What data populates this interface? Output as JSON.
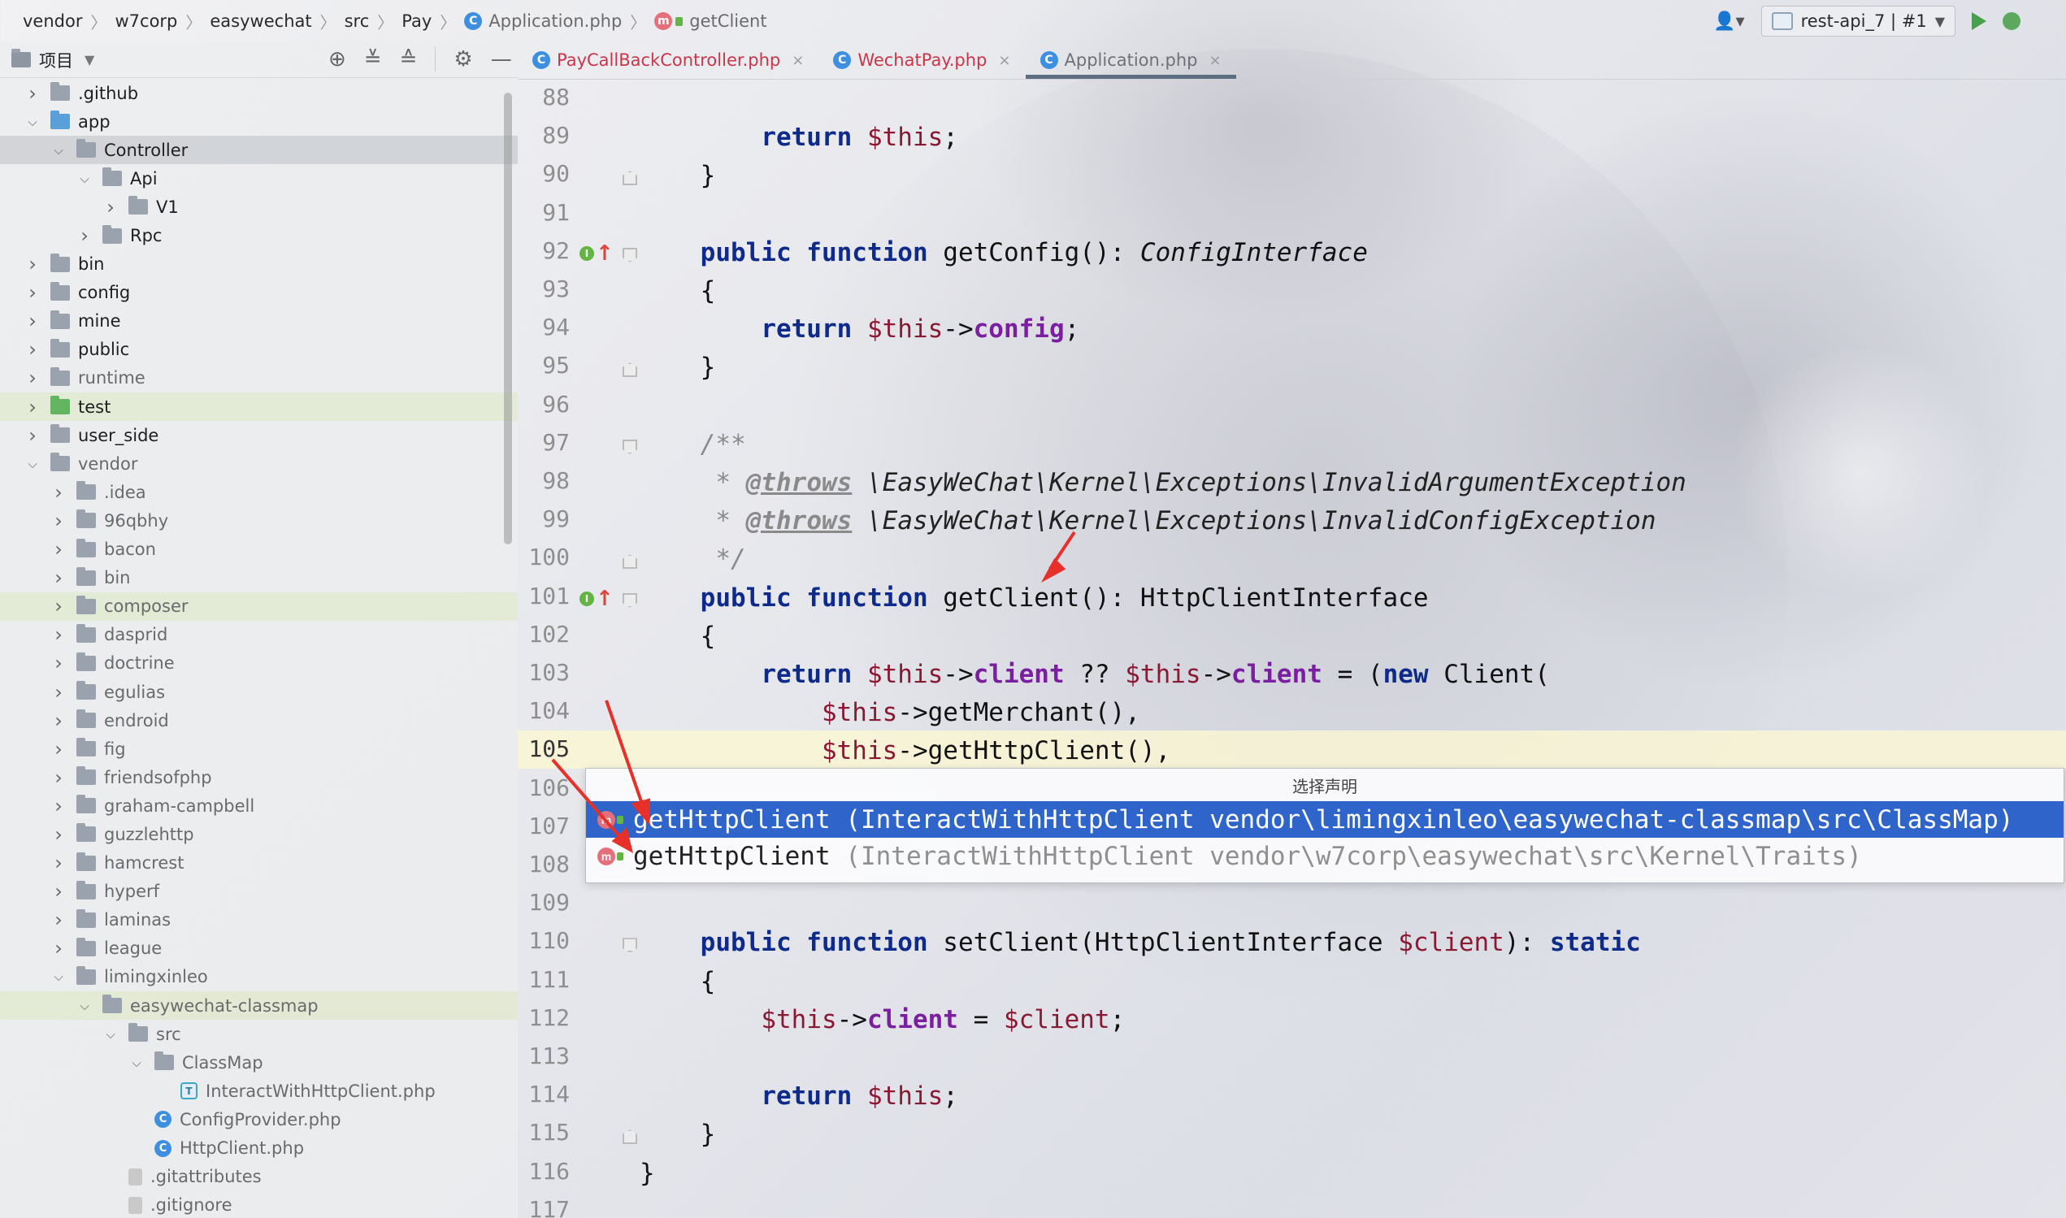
{
  "navbar": {
    "breadcrumbs": [
      "vendor",
      "w7corp",
      "easywechat",
      "src",
      "Pay"
    ],
    "file": "Application.php",
    "method": "getClient",
    "run_config": "rest-api_7 | #1"
  },
  "project_panel": {
    "title": "项目",
    "tree": [
      {
        "label": ".github",
        "depth": 0,
        "expanded": false
      },
      {
        "label": "app",
        "depth": 0,
        "expanded": true,
        "color": "blue"
      },
      {
        "label": "Controller",
        "depth": 1,
        "expanded": true,
        "selected": true
      },
      {
        "label": "Api",
        "depth": 2,
        "expanded": true
      },
      {
        "label": "V1",
        "depth": 3,
        "expanded": false
      },
      {
        "label": "Rpc",
        "depth": 2,
        "expanded": false
      },
      {
        "label": "bin",
        "depth": 0,
        "expanded": false
      },
      {
        "label": "config",
        "depth": 0,
        "expanded": false
      },
      {
        "label": "mine",
        "depth": 0,
        "expanded": false
      },
      {
        "label": "public",
        "depth": 0,
        "expanded": false
      },
      {
        "label": "runtime",
        "depth": 0,
        "expanded": false,
        "muted": true
      },
      {
        "label": "test",
        "depth": 0,
        "expanded": false,
        "color": "green",
        "highlight": true
      },
      {
        "label": "user_side",
        "depth": 0,
        "expanded": false
      },
      {
        "label": "vendor",
        "depth": 0,
        "expanded": true,
        "muted": true
      },
      {
        "label": ".idea",
        "depth": 1,
        "expanded": false,
        "muted": true
      },
      {
        "label": "96qbhy",
        "depth": 1,
        "expanded": false,
        "muted": true
      },
      {
        "label": "bacon",
        "depth": 1,
        "expanded": false,
        "muted": true
      },
      {
        "label": "bin",
        "depth": 1,
        "expanded": false,
        "muted": true
      },
      {
        "label": "composer",
        "depth": 1,
        "expanded": false,
        "muted": true,
        "highlight": true
      },
      {
        "label": "dasprid",
        "depth": 1,
        "expanded": false,
        "muted": true
      },
      {
        "label": "doctrine",
        "depth": 1,
        "expanded": false,
        "muted": true
      },
      {
        "label": "egulias",
        "depth": 1,
        "expanded": false,
        "muted": true
      },
      {
        "label": "endroid",
        "depth": 1,
        "expanded": false,
        "muted": true
      },
      {
        "label": "fig",
        "depth": 1,
        "expanded": false,
        "muted": true
      },
      {
        "label": "friendsofphp",
        "depth": 1,
        "expanded": false,
        "muted": true
      },
      {
        "label": "graham-campbell",
        "depth": 1,
        "expanded": false,
        "muted": true
      },
      {
        "label": "guzzlehttp",
        "depth": 1,
        "expanded": false,
        "muted": true
      },
      {
        "label": "hamcrest",
        "depth": 1,
        "expanded": false,
        "muted": true
      },
      {
        "label": "hyperf",
        "depth": 1,
        "expanded": false,
        "muted": true
      },
      {
        "label": "laminas",
        "depth": 1,
        "expanded": false,
        "muted": true
      },
      {
        "label": "league",
        "depth": 1,
        "expanded": false,
        "muted": true
      },
      {
        "label": "limingxinleo",
        "depth": 1,
        "expanded": true,
        "muted": true
      },
      {
        "label": "easywechat-classmap",
        "depth": 2,
        "expanded": true,
        "muted": true,
        "highlight": true
      },
      {
        "label": "src",
        "depth": 3,
        "expanded": true,
        "muted": true
      },
      {
        "label": "ClassMap",
        "depth": 4,
        "expanded": true,
        "muted": true
      },
      {
        "label": "InteractWithHttpClient.php",
        "depth": 5,
        "file": "trait",
        "muted": true
      },
      {
        "label": "ConfigProvider.php",
        "depth": 4,
        "file": "class",
        "muted": true
      },
      {
        "label": "HttpClient.php",
        "depth": 4,
        "file": "class",
        "muted": true
      },
      {
        "label": ".gitattributes",
        "depth": 3,
        "file": "git",
        "muted": true
      },
      {
        "label": ".gitignore",
        "depth": 3,
        "file": "git",
        "muted": true
      }
    ]
  },
  "tabs": [
    {
      "label": "PayCallBackController.php",
      "style": "red"
    },
    {
      "label": "WechatPay.php",
      "style": "red"
    },
    {
      "label": "Application.php",
      "style": "gray",
      "active": true
    }
  ],
  "editor": {
    "current_line": 105,
    "lines": [
      {
        "n": "88",
        "t": ""
      },
      {
        "n": "89",
        "t": "        <span class='kw'>return</span> <span class='var'>$this</span>;"
      },
      {
        "n": "90",
        "t": "    }"
      },
      {
        "n": "91",
        "t": ""
      },
      {
        "n": "92",
        "t": "    <span class='kw'>public function</span> getConfig(): <span class='tp'>ConfigInterface</span>"
      },
      {
        "n": "93",
        "t": "    {"
      },
      {
        "n": "94",
        "t": "        <span class='kw'>return</span> <span class='var'>$this</span>-><span class='prop'>config</span>;"
      },
      {
        "n": "95",
        "t": "    }"
      },
      {
        "n": "96",
        "t": ""
      },
      {
        "n": "97",
        "t": "    <span class='cmt'>/**</span>"
      },
      {
        "n": "98",
        "t": "     <span class='cmt'>*</span> <span class='tag'>@throws</span> <span class='cmtd'>\\EasyWeChat\\Kernel\\Exceptions\\InvalidArgumentException</span>"
      },
      {
        "n": "99",
        "t": "     <span class='cmt'>*</span> <span class='tag'>@throws</span> <span class='cmtd'>\\EasyWeChat\\Kernel\\Exceptions\\InvalidConfigException</span>"
      },
      {
        "n": "100",
        "t": "     <span class='cmt'>*/</span>"
      },
      {
        "n": "101",
        "t": "    <span class='kw'>public function</span> getClient(): HttpClientInterface"
      },
      {
        "n": "102",
        "t": "    {"
      },
      {
        "n": "103",
        "t": "        <span class='kw'>return</span> <span class='var'>$this</span>-><span class='prop'>client</span> ?? <span class='var'>$this</span>-><span class='prop'>client</span> = (<span class='kw'>new</span> Client("
      },
      {
        "n": "104",
        "t": "            <span class='var'>$this</span>->getMerchant(),"
      },
      {
        "n": "105",
        "t": "            <span class='var'>$this</span>->getHttpClient(),"
      },
      {
        "n": "106",
        "t": ""
      },
      {
        "n": "107",
        "t": ""
      },
      {
        "n": "108",
        "t": ""
      },
      {
        "n": "109",
        "t": ""
      },
      {
        "n": "110",
        "t": "    <span class='kw'>public function</span> setClient(HttpClientInterface <span class='var'>$client</span>): <span class='kw'>static</span>"
      },
      {
        "n": "111",
        "t": "    {"
      },
      {
        "n": "112",
        "t": "        <span class='var'>$this</span>-><span class='prop'>client</span> = <span class='var'>$client</span>;"
      },
      {
        "n": "113",
        "t": ""
      },
      {
        "n": "114",
        "t": "        <span class='kw'>return</span> <span class='var'>$this</span>;"
      },
      {
        "n": "115",
        "t": "    }"
      },
      {
        "n": "116",
        "t": "}"
      },
      {
        "n": "117",
        "t": ""
      }
    ]
  },
  "popup": {
    "title": "选择声明",
    "items": [
      {
        "name": "getHttpClient",
        "location": " (InteractWithHttpClient vendor\\limingxinleo\\easywechat-classmap\\src\\ClassMap)",
        "selected": true
      },
      {
        "name": "getHttpClient",
        "location": " (InteractWithHttpClient vendor\\w7corp\\easywechat\\src\\Kernel\\Traits)",
        "selected": false
      }
    ]
  },
  "icons": [
    "chevron-right-icon",
    "folder-icon",
    "class-icon",
    "method-icon",
    "locate-icon",
    "expand-all-icon",
    "collapse-all-icon",
    "gear-icon",
    "minimize-icon",
    "user-icon",
    "run-icon",
    "debug-icon",
    "close-icon",
    "implements-icon",
    "override-up-icon"
  ],
  "colors": {
    "selection": "#2f65ca",
    "keyword": "#0e2a8a",
    "variable": "#8a1a33",
    "property": "#7a1fa0",
    "annotation_arrow": "#e8302a"
  }
}
